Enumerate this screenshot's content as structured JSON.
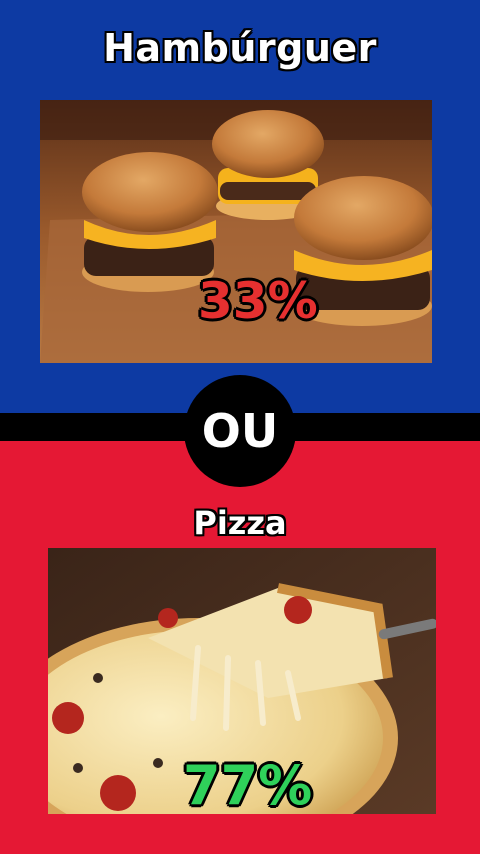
{
  "colors": {
    "top_bg": "#0d3aa3",
    "bottom_bg": "#e51834",
    "pct_a": "#e63030",
    "pct_b": "#2fd15a"
  },
  "option_a": {
    "title": "Hambúrguer",
    "percent": "33%",
    "image": "burgers-photo"
  },
  "separator": {
    "label": "OU"
  },
  "option_b": {
    "title": "Pizza",
    "percent": "77%",
    "image": "pizza-photo"
  }
}
